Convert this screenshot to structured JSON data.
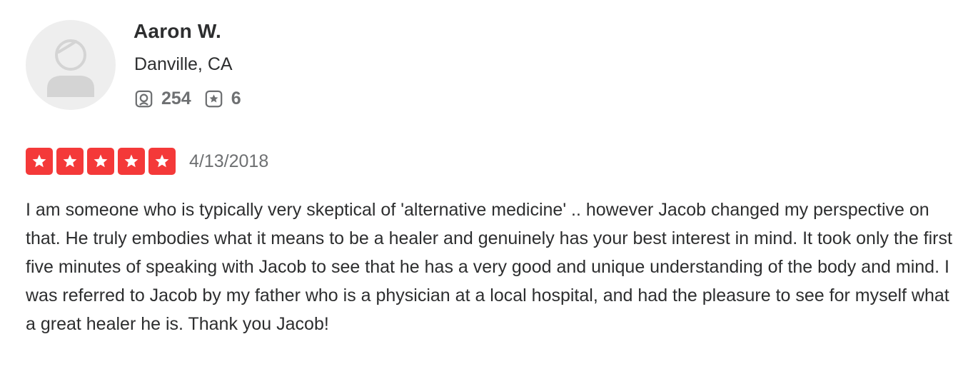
{
  "user": {
    "name": "Aaron W.",
    "location": "Danville, CA",
    "review_count": "254",
    "photo_count": "6",
    "avatar_icon": "default-user-avatar-icon"
  },
  "review": {
    "rating": 5,
    "rating_max": 5,
    "date": "4/13/2018",
    "text": "I am someone who is typically very skeptical of 'alternative medicine' .. however Jacob changed my perspective on that. He truly embodies what it means to be a healer and genuinely has your best interest in mind. It took only the first five minutes of speaking with Jacob to see that he has a very good and unique understanding of the body and mind. I was referred to Jacob by my father who is a physician at a local hospital, and had the pleasure to see for myself what a great healer he is. Thank you Jacob!"
  },
  "colors": {
    "star_fill": "#f43939",
    "text_primary": "#2d2e2f",
    "text_secondary": "#6e7072",
    "avatar_bg": "#eeeeee"
  },
  "icons": {
    "reviews": "review-count-icon",
    "photos": "star-badge-icon",
    "star": "star-icon"
  }
}
